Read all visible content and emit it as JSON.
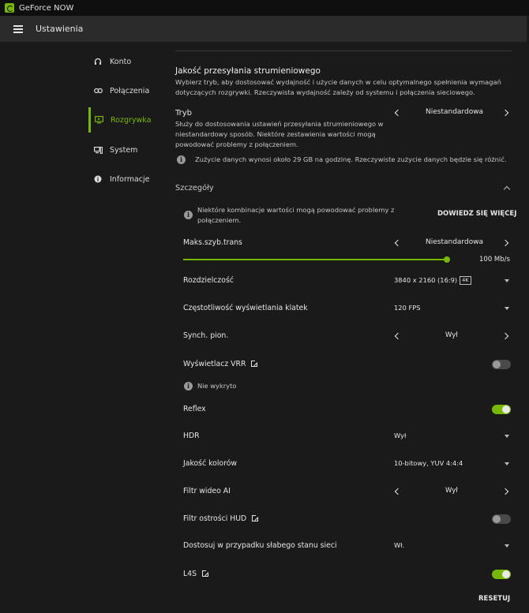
{
  "window": {
    "title": "GeForce NOW"
  },
  "header": {
    "title": "Ustawienia"
  },
  "sidebar": {
    "items": [
      {
        "label": "Konto",
        "icon": "headset-icon"
      },
      {
        "label": "Połączenia",
        "icon": "link-icon"
      },
      {
        "label": "Rozgrywka",
        "icon": "monitor-play-icon",
        "active": true
      },
      {
        "label": "System",
        "icon": "computer-icon"
      },
      {
        "label": "Informacje",
        "icon": "info-icon"
      }
    ]
  },
  "stream": {
    "title": "Jakość przesyłania strumieniowego",
    "desc_line1": "Wybierz tryb, aby dostosować wydajność i użycie danych w celu optymalnego spełnienia wymagań",
    "desc_line2": "dotyczących rozgrywki. Rzeczywista wydajność zależy od systemu i połączenia sieciowego.",
    "mode_label": "Tryb",
    "mode_value": "Niestandardowa",
    "mode_desc_line1": "Służy do dostosowania ustawień przesyłania strumieniowego w",
    "mode_desc_line2": "niestandardowy sposób. Niektóre zestawienia wartości mogą",
    "mode_desc_line3": "powodować problemy z połączeniem.",
    "data_usage_note": "Zużycie danych wynosi około 29 GB na godzinę. Rzeczywiste zużycie danych będzie się różnić."
  },
  "details": {
    "title": "Szczegóły",
    "warning_line1": "Niektóre kombinacje wartości mogą powodować problemy z",
    "warning_line2": "połączeniem.",
    "learn_more": "DOWIEDZ SIĘ WIĘCEJ",
    "max_bitrate": {
      "label": "Maks.szyb.trans",
      "value": "Niestandardowa",
      "readout": "100 Mb/s",
      "fraction": 1.0
    },
    "resolution": {
      "label": "Rozdzielczość",
      "value": "3840 x 2160 (16:9)",
      "badge": "4K"
    },
    "frame_rate": {
      "label": "Częstotliwość wyświetlania klatek",
      "value": "120 FPS"
    },
    "vsync": {
      "label": "Synch. pion.",
      "value": "Wył"
    },
    "vrr": {
      "label": "Wyświetlacz VRR",
      "on": false,
      "note": "Nie wykryto"
    },
    "reflex": {
      "label": "Reflex",
      "on": true
    },
    "hdr": {
      "label": "HDR",
      "value": "Wył"
    },
    "color_quality": {
      "label": "Jakość kolorów",
      "value": "10-bitowy, YUV 4:4:4"
    },
    "ai_filter": {
      "label": "Filtr wideo AI",
      "value": "Wył"
    },
    "hud_filter": {
      "label": "Filtr ostrości HUD",
      "on": false
    },
    "poor_network": {
      "label": "Dostosuj w przypadku słabego stanu sieci",
      "value": "Wł."
    },
    "l4s": {
      "label": "L4S",
      "on": true
    },
    "reset": "RESETUJ"
  },
  "colors": {
    "accent": "#76b900",
    "background": "#1a1a1a",
    "header": "#2b2b2b"
  }
}
